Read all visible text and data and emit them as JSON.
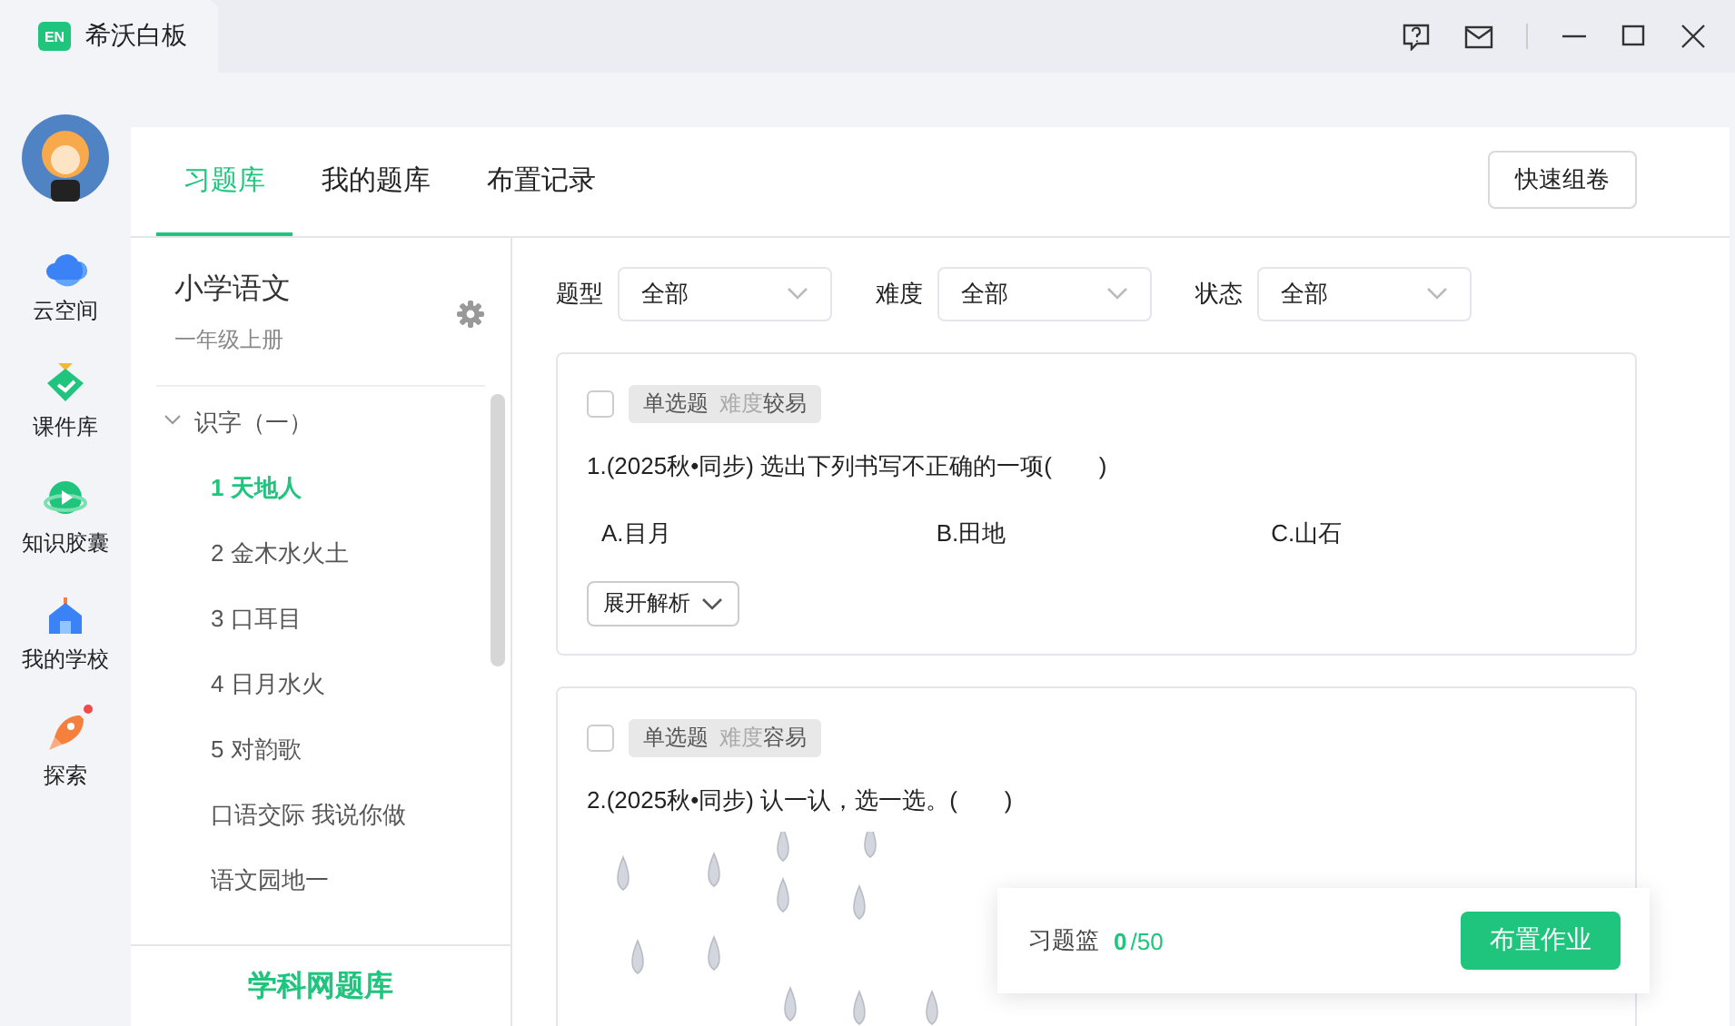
{
  "window": {
    "title": "希沃白板",
    "logo_text": "EN"
  },
  "nav": [
    {
      "label": "云空间",
      "kind": "cloud",
      "dot": false
    },
    {
      "label": "课件库",
      "kind": "diamond",
      "dot": false
    },
    {
      "label": "知识胶囊",
      "kind": "capsule",
      "dot": false
    },
    {
      "label": "我的学校",
      "kind": "school",
      "dot": false
    },
    {
      "label": "探索",
      "kind": "rocket",
      "dot": true
    }
  ],
  "tabs": [
    {
      "label": "习题库",
      "selected": true
    },
    {
      "label": "我的题库",
      "selected": false
    },
    {
      "label": "布置记录",
      "selected": false
    }
  ],
  "quick_button": "快速组卷",
  "book": {
    "subject": "小学语文",
    "grade": "一年级上册"
  },
  "tree": [
    {
      "label": "识字（一）",
      "expanded": true,
      "children": [
        {
          "label": "1 天地人",
          "selected": true
        },
        {
          "label": "2 金木水火土",
          "selected": false
        },
        {
          "label": "3 口耳目",
          "selected": false
        },
        {
          "label": "4 日月水火",
          "selected": false
        },
        {
          "label": "5 对韵歌",
          "selected": false
        },
        {
          "label": "口语交际 我说你做",
          "selected": false
        },
        {
          "label": "语文园地一",
          "selected": false
        }
      ]
    }
  ],
  "footer_link": "学科网题库",
  "filters": [
    {
      "label": "题型",
      "value": "全部"
    },
    {
      "label": "难度",
      "value": "全部"
    },
    {
      "label": "状态",
      "value": "全部"
    }
  ],
  "questions": [
    {
      "checked": false,
      "type": "单选题",
      "difficulty_label": "难度",
      "difficulty": "较易",
      "stem": "1.(2025秋•同步) 选出下列书写不正确的一项(　　)",
      "options": [
        "A.目月",
        "B.田地",
        "C.山石"
      ],
      "expand_button": "展开解析"
    },
    {
      "checked": false,
      "type": "单选题",
      "difficulty_label": "难度",
      "difficulty": "容易",
      "stem": "2.(2025秋•同步) 认一认，选一选。(　　)",
      "figure": {
        "kind": "raindrops"
      }
    }
  ],
  "basket": {
    "label": "习题篮",
    "count": "0",
    "total": "/50",
    "button": "布置作业"
  }
}
